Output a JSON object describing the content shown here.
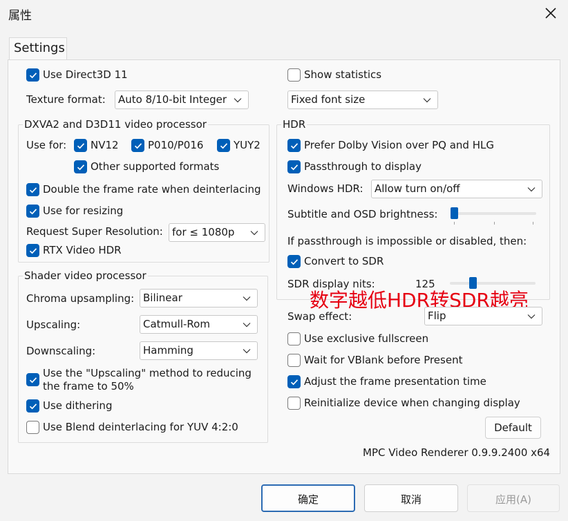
{
  "window": {
    "title": "属性"
  },
  "tab": {
    "label": "Settings"
  },
  "left": {
    "use_d3d11": {
      "label": "Use Direct3D 11",
      "checked": true
    },
    "texture_format": {
      "label": "Texture format:",
      "value": "Auto 8/10-bit Integer"
    },
    "dxva_group": {
      "title": "DXVA2 and D3D11 video processor",
      "use_for_label": "Use for:",
      "nv12": {
        "label": "NV12",
        "checked": true
      },
      "p010": {
        "label": "P010/P016",
        "checked": true
      },
      "yuy2": {
        "label": "YUY2",
        "checked": true
      },
      "other_formats": {
        "label": "Other supported formats",
        "checked": true
      },
      "double_frame_rate": {
        "label": "Double the frame rate when deinterlacing",
        "checked": true
      },
      "use_for_resizing": {
        "label": "Use for resizing",
        "checked": true
      },
      "super_res": {
        "label": "Request Super Resolution:",
        "value": "for ≤ 1080p"
      },
      "rtx_hdr": {
        "label": "RTX Video HDR",
        "checked": true
      }
    },
    "shader_group": {
      "title": "Shader video processor",
      "chroma": {
        "label": "Chroma upsampling:",
        "value": "Bilinear"
      },
      "upscaling": {
        "label": "Upscaling:",
        "value": "Catmull-Rom"
      },
      "downscaling": {
        "label": "Downscaling:",
        "value": "Hamming"
      },
      "use_upscaling_method": {
        "label_line1": "Use the \"Upscaling\" method to reducing",
        "label_line2": "the frame to 50%",
        "checked": true
      },
      "dithering": {
        "label": "Use dithering",
        "checked": true
      },
      "blend_deinterlace": {
        "label": "Use Blend deinterlacing for YUV 4:2:0",
        "checked": false
      }
    }
  },
  "right": {
    "show_statistics": {
      "label": "Show statistics",
      "checked": false
    },
    "font_size": {
      "value": "Fixed font size"
    },
    "hdr_group": {
      "title": "HDR",
      "prefer_dolby": {
        "label": "Prefer Dolby Vision over PQ and HLG",
        "checked": true
      },
      "passthrough": {
        "label": "Passthrough to display",
        "checked": true
      },
      "windows_hdr": {
        "label": "Windows HDR:",
        "value": "Allow turn on/off"
      },
      "subtitle_brightness": {
        "label": "Subtitle and OSD brightness:",
        "level": 0.0
      },
      "if_impossible": "If passthrough is impossible or disabled, then:",
      "convert_sdr": {
        "label": "Convert to SDR",
        "checked": true
      },
      "sdr_nits": {
        "label": "SDR display nits:",
        "value": "125",
        "level": 0.25
      }
    },
    "annotation": "数字越低HDR转SDR越亮",
    "swap_effect": {
      "label": "Swap effect:",
      "value": "Flip"
    },
    "exclusive_fullscreen": {
      "label": "Use exclusive fullscreen",
      "checked": false
    },
    "wait_vblank": {
      "label": "Wait for VBlank before Present",
      "checked": false
    },
    "adjust_frame": {
      "label": "Adjust the frame presentation time",
      "checked": true
    },
    "reinit_device": {
      "label": "Reinitialize device when changing display",
      "checked": false
    },
    "default_button": "Default",
    "version": "MPC Video Renderer 0.9.9.2400 x64"
  },
  "footer": {
    "ok": "确定",
    "cancel": "取消",
    "apply": "应用(A)"
  },
  "colors": {
    "accent": "#005fb8",
    "annotation": "#e60012"
  }
}
